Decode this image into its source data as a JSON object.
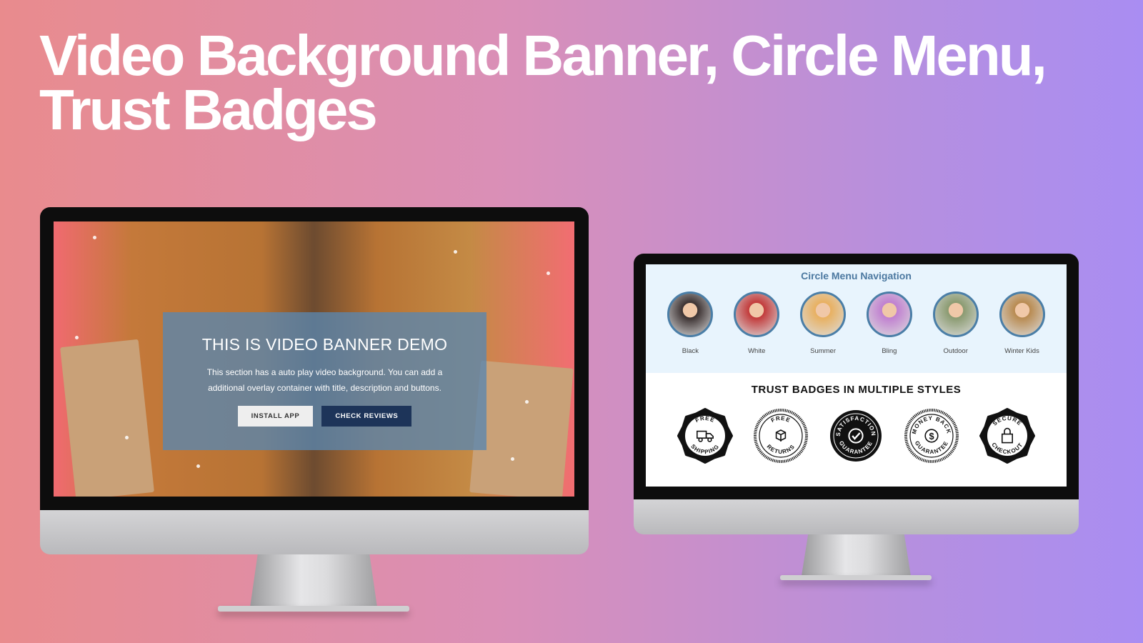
{
  "headline": {
    "line1": "Video Background Banner,  Circle Menu,",
    "line2": "Trust Badges"
  },
  "banner": {
    "title": "THIS IS VIDEO BANNER DEMO",
    "description": "This section has a auto play video background. You can add a additional overlay container with title, description and buttons.",
    "buttons": [
      {
        "label": "INSTALL APP"
      },
      {
        "label": "CHECK REVIEWS"
      }
    ],
    "colors": {
      "overlay": "#5a87af",
      "secondary_button": "#1d3459"
    }
  },
  "circle_menu": {
    "title": "Circle Menu Navigation",
    "items": [
      {
        "label": "Black",
        "color": "#3a3030"
      },
      {
        "label": "White",
        "color": "#c23a3a"
      },
      {
        "label": "Summer",
        "color": "#e8b060"
      },
      {
        "label": "Bling",
        "color": "#c080d0"
      },
      {
        "label": "Outdoor",
        "color": "#8a9a70"
      },
      {
        "label": "Winter Kids",
        "color": "#b88a50"
      }
    ],
    "border_color": "#4a7ea7"
  },
  "trust_badges": {
    "title": "TRUST BADGES IN MULTIPLE STYLES",
    "badges": [
      {
        "top": "FREE",
        "bottom": "SHIPPING",
        "icon": "truck-icon"
      },
      {
        "top": "FREE",
        "bottom": "RETURNS",
        "icon": "box-return-icon"
      },
      {
        "top": "SATISFACTION",
        "bottom": "GUARANTEE",
        "icon": "check-icon"
      },
      {
        "top": "MONEY BACK",
        "bottom": "GUARANTEE",
        "icon": "dollar-icon"
      },
      {
        "top": "SECURE",
        "bottom": "CHECKOUT",
        "icon": "lock-icon"
      }
    ]
  }
}
